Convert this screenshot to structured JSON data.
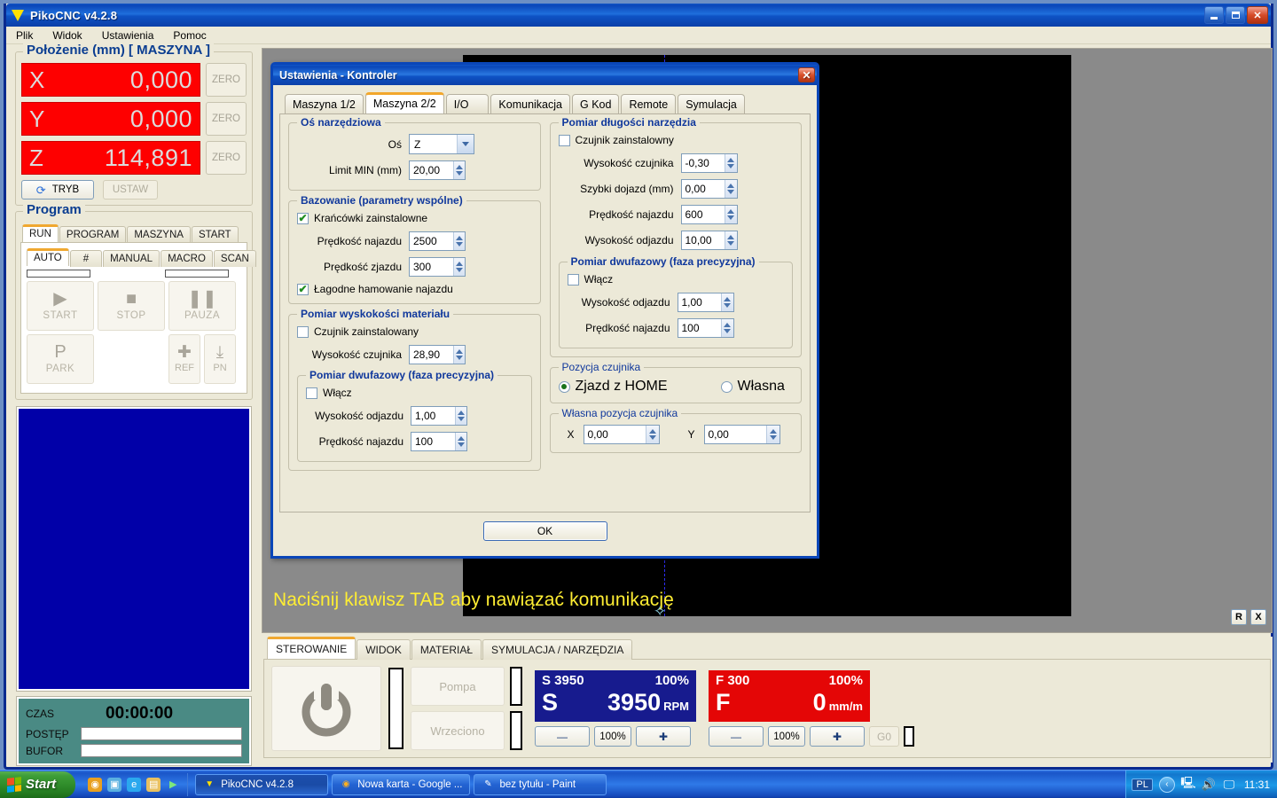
{
  "window": {
    "title": "PikoCNC v4.2.8",
    "minimize_label": "Minimize",
    "maximize_label": "Maximize",
    "close_label": "✕"
  },
  "menu": [
    "Plik",
    "Widok",
    "Ustawienia",
    "Pomoc"
  ],
  "position_panel": {
    "title": "Położenie (mm) [ MASZYNA ]",
    "axes": [
      {
        "name": "X",
        "value": "0,000",
        "zero_label": "ZERO"
      },
      {
        "name": "Y",
        "value": "0,000",
        "zero_label": "ZERO"
      },
      {
        "name": "Z",
        "value": "114,891",
        "zero_label": "ZERO"
      }
    ],
    "tryb_label": "TRYB",
    "tryb_icon": "refresh-icon",
    "ustaw_label": "USTAW",
    "dro_bg": "#fe0000"
  },
  "program_panel": {
    "title": "Program",
    "tabs": [
      {
        "label": "RUN",
        "active": true
      },
      {
        "label": "PROGRAM",
        "active": false
      },
      {
        "label": "MASZYNA",
        "active": false
      },
      {
        "label": "START",
        "active": false
      }
    ],
    "subtabs": [
      {
        "label": "AUTO",
        "active": true
      },
      {
        "label": "#",
        "active": false
      },
      {
        "label": "MANUAL",
        "active": false
      },
      {
        "label": "MACRO",
        "active": false
      },
      {
        "label": "SCAN",
        "active": false
      }
    ],
    "buttons": [
      {
        "label": "START",
        "icon": "play-icon",
        "glyph": "▶"
      },
      {
        "label": "STOP",
        "icon": "stop-icon",
        "glyph": "■"
      },
      {
        "label": "PAUZA",
        "icon": "pause-icon",
        "glyph": "❚❚"
      }
    ],
    "buttons_row2": [
      {
        "label": "PARK",
        "icon": "park-icon",
        "glyph": "P"
      }
    ],
    "small_buttons": [
      {
        "label": "REF",
        "icon": "plus-icon",
        "glyph": "✚"
      },
      {
        "label": "PN",
        "icon": "down-to-line-icon",
        "glyph": "⤓"
      }
    ],
    "canvas_color": "#0100a8"
  },
  "status_panel": {
    "time_label": "CZAS",
    "time_value": "00:00:00",
    "progress_label": "POSTĘP",
    "buffer_label": "BUFOR",
    "progress_percent": 0,
    "buffer_percent": 0,
    "bg_color": "#4a8a84"
  },
  "viewport": {
    "message": "Naciśnij klawisz TAB aby nawiązać komunikację",
    "message_color": "#ffee33",
    "background": "#8a8a8a",
    "plot_background": "#000000",
    "corner_buttons": [
      {
        "label": "R",
        "name": "reset-view-button"
      },
      {
        "label": "X",
        "name": "close-view-button"
      }
    ],
    "crosshair_icon": "crosshair-marker-icon"
  },
  "bottom_bar": {
    "tabs": [
      {
        "label": "STEROWANIE",
        "active": true
      },
      {
        "label": "WIDOK",
        "active": false
      },
      {
        "label": "MATERIAŁ",
        "active": false
      },
      {
        "label": "SYMULACJA / NARZĘDZIA",
        "active": false
      }
    ],
    "power_icon": "power-icon",
    "toggles": [
      {
        "label": "Pompa",
        "name": "pump-toggle"
      },
      {
        "label": "Wrzeciono",
        "name": "spindle-toggle"
      }
    ],
    "spindle": {
      "header_left": "S 3950",
      "header_right": "100%",
      "letter": "S",
      "value": "3950",
      "unit": "RPM",
      "bg": "#171b8e",
      "minus_label": "—",
      "reset_label": "100%",
      "plus_label": "✚"
    },
    "feed": {
      "header_left": "F 300",
      "header_right": "100%",
      "letter": "F",
      "value": "0",
      "unit": "mm/m",
      "bg": "#e40606",
      "minus_label": "—",
      "reset_label": "100%",
      "plus_label": "✚",
      "g0_label": "G0"
    }
  },
  "dialog": {
    "title": "Ustawienia - Kontroler",
    "close_label": "✕",
    "tabs": [
      {
        "label": "Maszyna 1/2",
        "active": false
      },
      {
        "label": "Maszyna 2/2",
        "active": true
      },
      {
        "label": "I/O",
        "active": false
      },
      {
        "label": "Komunikacja",
        "active": false
      },
      {
        "label": "G Kod",
        "active": false
      },
      {
        "label": "Remote",
        "active": false
      },
      {
        "label": "Symulacja",
        "active": false
      }
    ],
    "tool_axis": {
      "title": "Oś narzędziowa",
      "axis_label": "Oś",
      "axis_value": "Z",
      "limit_label": "Limit MIN (mm)",
      "limit_value": "20,00"
    },
    "homing": {
      "title": "Bazowanie (parametry wspólne)",
      "limits_installed_label": "Krańcówki  zainstalowne",
      "limits_installed_checked": true,
      "approach_speed_label": "Prędkość najazdu",
      "approach_speed_value": "2500",
      "retract_speed_label": "Prędkość zjazdu",
      "retract_speed_value": "300",
      "soft_brake_label": "Łagodne hamowanie najazdu",
      "soft_brake_checked": true
    },
    "material_height": {
      "title": "Pomiar wyskokości materiału",
      "sensor_label": "Czujnik zainstalowany",
      "sensor_checked": false,
      "sensor_height_label": "Wysokość czujnika",
      "sensor_height_value": "28,90",
      "two_phase": {
        "title": "Pomiar dwufazowy (faza precyzyjna)",
        "enable_label": "Włącz",
        "enable_checked": false,
        "retract_height_label": "Wysokość odjazdu",
        "retract_height_value": "1,00",
        "approach_speed_label": "Prędkość najazdu",
        "approach_speed_value": "100"
      }
    },
    "tool_length": {
      "title": "Pomiar długości narzędzia",
      "sensor_label": "Czujnik zainstalowny",
      "sensor_checked": false,
      "sensor_height_label": "Wysokość czujnika",
      "sensor_height_value": "-0,30",
      "fast_approach_label": "Szybki dojazd (mm)",
      "fast_approach_value": "0,00",
      "approach_speed_label": "Prędkość najazdu",
      "approach_speed_value": "600",
      "retract_height_label": "Wysokość odjazdu",
      "retract_height_value": "10,00",
      "two_phase": {
        "title": "Pomiar dwufazowy (faza precyzyjna)",
        "enable_label": "Włącz",
        "enable_checked": false,
        "retract_height_label": "Wysokość odjazdu",
        "retract_height_value": "1,00",
        "approach_speed_label": "Prędkość najazdu",
        "approach_speed_value": "100"
      }
    },
    "sensor_position": {
      "title": "Pozycja czujnika",
      "option_home_label": "Zjazd z HOME",
      "option_home_selected": true,
      "option_custom_label": "Własna",
      "option_custom_selected": false
    },
    "custom_sensor_position": {
      "title": "Własna pozycja czujnika",
      "x_label": "X",
      "x_value": "0,00",
      "y_label": "Y",
      "y_value": "0,00"
    },
    "ok_label": "OK"
  },
  "taskbar": {
    "start_label": "Start",
    "quicklaunch": [
      {
        "name": "chrome-icon",
        "glyph": "◉",
        "color": "#e8a020"
      },
      {
        "name": "media-icon",
        "glyph": "▣",
        "color": "#5ab0e0"
      },
      {
        "name": "internet-explorer-icon",
        "glyph": "e",
        "color": "#2aa8ee"
      },
      {
        "name": "folder-icon",
        "glyph": "▤",
        "color": "#e8c060"
      },
      {
        "name": "play-icon",
        "glyph": "▶",
        "color": "#5ad05a"
      }
    ],
    "tasks": [
      {
        "label": "PikoCNC v4.2.8",
        "icon": "pikocnc-icon",
        "glyph": "▼",
        "color": "#ffe000",
        "active": true
      },
      {
        "label": "Nowa karta - Google ...",
        "icon": "chrome-icon",
        "glyph": "◉",
        "color": "#e8a020",
        "active": false
      },
      {
        "label": "bez tytułu - Paint",
        "icon": "paint-icon",
        "glyph": "✎",
        "color": "#f0f0f0",
        "active": false
      }
    ],
    "tray": {
      "language": "PL",
      "chevron": "‹",
      "icons": [
        {
          "name": "network-icon",
          "glyph": "🖳"
        },
        {
          "name": "volume-icon",
          "glyph": "🔊"
        },
        {
          "name": "display-icon",
          "glyph": "🖵"
        }
      ],
      "clock": "11:31"
    }
  }
}
